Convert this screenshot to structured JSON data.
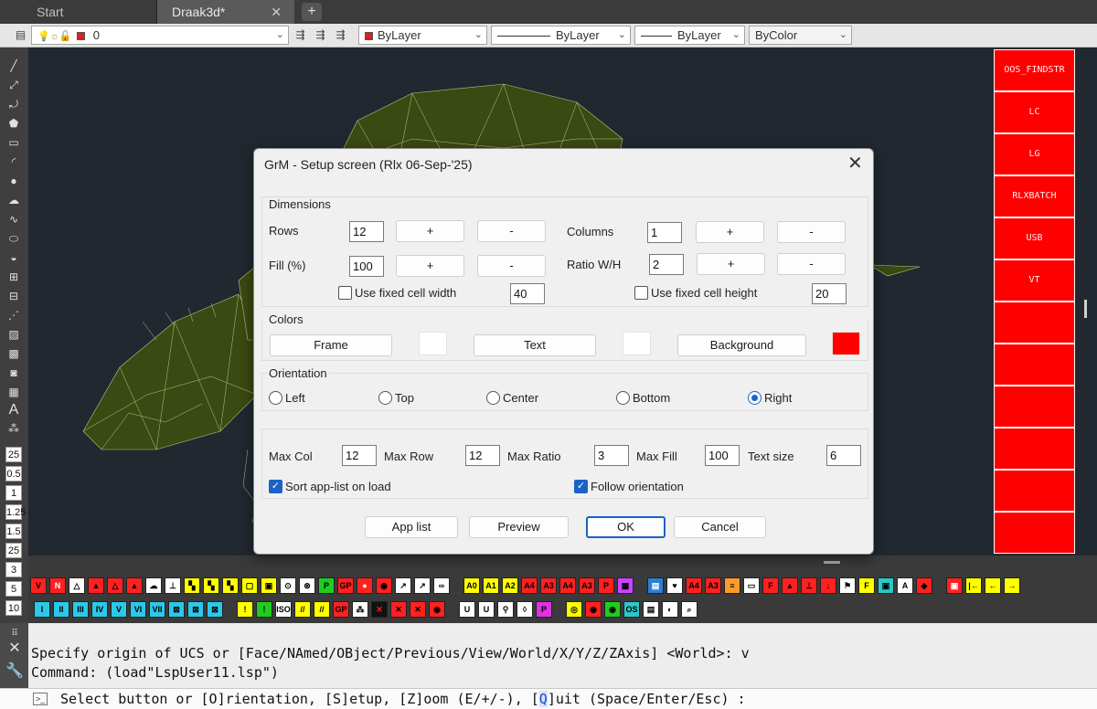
{
  "tabs": {
    "start": "Start",
    "active": "Draak3d*",
    "close_glyph": "✕",
    "new_glyph": "+"
  },
  "propbar": {
    "layer_value": "0",
    "color_value": "ByLayer",
    "linetype_value": "ByLayer",
    "lineweight_value": "ByLayer",
    "plotstyle_value": "ByColor"
  },
  "left_numbers": [
    "25",
    "0.5",
    "1",
    "1.25",
    "1.5",
    "25",
    "3",
    "5",
    "10"
  ],
  "red_panel": {
    "items": [
      "OOS_FINDSTR",
      "LC",
      "LG",
      "RLXBATCH",
      "USB",
      "VT",
      "",
      "",
      "",
      "",
      "",
      ""
    ]
  },
  "dialog": {
    "title": "GrM - Setup screen (Rlx 06-Sep-'25)",
    "close_glyph": "✕",
    "dimensions": {
      "label": "Dimensions",
      "rows_label": "Rows",
      "rows_value": "12",
      "fill_label": "Fill  (%)",
      "fill_value": "100",
      "columns_label": "Columns",
      "columns_value": "1",
      "ratio_label": "Ratio W/H",
      "ratio_value": "2",
      "plus": "+",
      "minus": "-",
      "fixed_width_label": "Use fixed cell width",
      "fixed_width_value": "40",
      "fixed_height_label": "Use fixed cell height",
      "fixed_height_value": "20"
    },
    "colors": {
      "label": "Colors",
      "frame_label": "Frame",
      "text_label": "Text",
      "background_label": "Background",
      "frame_color": "#ffffff",
      "text_color": "#ffffff",
      "background_color": "#ff0000"
    },
    "orientation": {
      "label": "Orientation",
      "options": [
        "Left",
        "Top",
        "Center",
        "Bottom",
        "Right"
      ],
      "selected": "Right"
    },
    "limits": {
      "max_col_label": "Max Col",
      "max_col_value": "12",
      "max_row_label": "Max Row",
      "max_row_value": "12",
      "max_ratio_label": "Max Ratio",
      "max_ratio_value": "3",
      "max_fill_label": "Max Fill",
      "max_fill_value": "100",
      "text_size_label": "Text size",
      "text_size_value": "6",
      "sort_label": "Sort app-list on load",
      "sort_checked": true,
      "follow_label": "Follow orientation",
      "follow_checked": true
    },
    "buttons": {
      "app_list": "App list",
      "preview": "Preview",
      "ok": "OK",
      "cancel": "Cancel"
    }
  },
  "command": {
    "line1": "Specify origin of UCS or [Face/NAmed/OBject/Previous/View/World/X/Y/Z/ZAxis] <World>: v",
    "line2": "Command: (load\"LspUser11.lsp\")",
    "prompt_before": "Select button or [O]rientation, [S]etup, [Z]oom (E/+/-), [",
    "prompt_q": "Q",
    "prompt_after": "]uit (Space/Enter/Esc) :"
  },
  "tool_rows": {
    "row1": [
      {
        "t": "V",
        "bg": "#ff2020",
        "fg": "#000"
      },
      {
        "t": "N",
        "bg": "#ff2020",
        "fg": "#fff"
      },
      {
        "t": "△",
        "bg": "#ffffff",
        "fg": "#000"
      },
      {
        "t": "▲",
        "bg": "#ff2020",
        "fg": "#000"
      },
      {
        "t": "△",
        "bg": "#ff2020",
        "fg": "#000"
      },
      {
        "t": "▲",
        "bg": "#ff2020",
        "fg": "#000"
      },
      {
        "t": "☁",
        "bg": "#ffffff",
        "fg": "#000"
      },
      {
        "t": "⊥",
        "bg": "#ffffff",
        "fg": "#000"
      },
      {
        "t": "▚",
        "bg": "#ffff00",
        "fg": "#000"
      },
      {
        "t": "▚",
        "bg": "#ffff00",
        "fg": "#000"
      },
      {
        "t": "▚",
        "bg": "#ffff00",
        "fg": "#000"
      },
      {
        "t": "▢",
        "bg": "#ffff00",
        "fg": "#000"
      },
      {
        "t": "▣",
        "bg": "#ffff00",
        "fg": "#000"
      },
      {
        "t": "⊙",
        "bg": "#ffffff",
        "fg": "#000"
      },
      {
        "t": "⊗",
        "bg": "#ffffff",
        "fg": "#000"
      },
      {
        "t": "P",
        "bg": "#20cc20",
        "fg": "#000"
      },
      {
        "t": "GP",
        "bg": "#ff2020",
        "fg": "#000"
      },
      {
        "t": "●",
        "bg": "#ff2020",
        "fg": "#fff"
      },
      {
        "t": "◉",
        "bg": "#ff2020",
        "fg": "#000"
      },
      {
        "t": "↗",
        "bg": "#ffffff",
        "fg": "#000"
      },
      {
        "t": "↗",
        "bg": "#ffffff",
        "fg": "#000"
      },
      {
        "t": "∞",
        "bg": "#ffffff",
        "fg": "#000"
      },
      {
        "t": "A0",
        "bg": "#ffff00",
        "fg": "#000"
      },
      {
        "t": "A1",
        "bg": "#ffff00",
        "fg": "#000"
      },
      {
        "t": "A2",
        "bg": "#ffff00",
        "fg": "#000"
      },
      {
        "t": "A4",
        "bg": "#ff2020",
        "fg": "#000"
      },
      {
        "t": "A3",
        "bg": "#ff2020",
        "fg": "#000"
      },
      {
        "t": "A4",
        "bg": "#ff2020",
        "fg": "#000"
      },
      {
        "t": "A3",
        "bg": "#ff2020",
        "fg": "#000"
      },
      {
        "t": "P",
        "bg": "#ff2020",
        "fg": "#000"
      },
      {
        "t": "▦",
        "bg": "#cc44ff",
        "fg": "#000"
      },
      {
        "t": "▤",
        "bg": "#2c7fd8",
        "fg": "#fff"
      },
      {
        "t": "♥",
        "bg": "#ffffff",
        "fg": "#000"
      },
      {
        "t": "A4",
        "bg": "#ff2020",
        "fg": "#000"
      },
      {
        "t": "A3",
        "bg": "#ff2020",
        "fg": "#000"
      },
      {
        "t": "≡",
        "bg": "#ff9a2c",
        "fg": "#000"
      },
      {
        "t": "▭",
        "bg": "#ffffff",
        "fg": "#000"
      },
      {
        "t": "F",
        "bg": "#ff2020",
        "fg": "#000"
      },
      {
        "t": "▲",
        "bg": "#ff2020",
        "fg": "#000"
      },
      {
        "t": "⊥",
        "bg": "#ff2020",
        "fg": "#000"
      },
      {
        "t": "↓",
        "bg": "#ff2020",
        "fg": "#000"
      },
      {
        "t": "⚑",
        "bg": "#ffffff",
        "fg": "#000"
      },
      {
        "t": "F",
        "bg": "#ffff00",
        "fg": "#000"
      },
      {
        "t": "▣",
        "bg": "#2cc8c8",
        "fg": "#000"
      },
      {
        "t": "A",
        "bg": "#ffffff",
        "fg": "#000"
      },
      {
        "t": "◆",
        "bg": "#ff2020",
        "fg": "#000"
      },
      {
        "t": "▣",
        "bg": "#ff2020",
        "fg": "#fff"
      },
      {
        "t": "|←",
        "bg": "#ffff00",
        "fg": "#000"
      },
      {
        "t": "←",
        "bg": "#ffff00",
        "fg": "#000"
      },
      {
        "t": "→",
        "bg": "#ffff00",
        "fg": "#000"
      }
    ],
    "row2": [
      {
        "t": "I",
        "bg": "#2cc8e8",
        "fg": "#000"
      },
      {
        "t": "II",
        "bg": "#2cc8e8",
        "fg": "#000"
      },
      {
        "t": "III",
        "bg": "#2cc8e8",
        "fg": "#000"
      },
      {
        "t": "IV",
        "bg": "#2cc8e8",
        "fg": "#000"
      },
      {
        "t": "V",
        "bg": "#2cc8e8",
        "fg": "#000"
      },
      {
        "t": "VI",
        "bg": "#2cc8e8",
        "fg": "#000"
      },
      {
        "t": "VII",
        "bg": "#2cc8e8",
        "fg": "#000"
      },
      {
        "t": "⊠",
        "bg": "#2cc8e8",
        "fg": "#000"
      },
      {
        "t": "⊠",
        "bg": "#2cc8e8",
        "fg": "#000"
      },
      {
        "t": "⊠",
        "bg": "#2cc8e8",
        "fg": "#000"
      },
      {
        "t": "!",
        "bg": "#ffff00",
        "fg": "#000"
      },
      {
        "t": "!",
        "bg": "#20cc20",
        "fg": "#000"
      },
      {
        "t": "ISO",
        "bg": "#ffffff",
        "fg": "#000"
      },
      {
        "t": "//",
        "bg": "#ffff00",
        "fg": "#000"
      },
      {
        "t": "//",
        "bg": "#ffff00",
        "fg": "#000"
      },
      {
        "t": "GP",
        "bg": "#ff2020",
        "fg": "#000"
      },
      {
        "t": "⁂",
        "bg": "#ffffff",
        "fg": "#000"
      },
      {
        "t": "✕",
        "bg": "#111111",
        "fg": "#ff2020"
      },
      {
        "t": "✕",
        "bg": "#ff2020",
        "fg": "#000"
      },
      {
        "t": "✕",
        "bg": "#ff2020",
        "fg": "#000"
      },
      {
        "t": "◉",
        "bg": "#ff2020",
        "fg": "#000"
      },
      {
        "t": "U",
        "bg": "#ffffff",
        "fg": "#000"
      },
      {
        "t": "U",
        "bg": "#ffffff",
        "fg": "#000"
      },
      {
        "t": "⚲",
        "bg": "#ffffff",
        "fg": "#000"
      },
      {
        "t": "◊",
        "bg": "#ffffff",
        "fg": "#000"
      },
      {
        "t": "P",
        "bg": "#dd33dd",
        "fg": "#000"
      },
      {
        "t": "◎",
        "bg": "#ffff00",
        "fg": "#000"
      },
      {
        "t": "◉",
        "bg": "#ff2020",
        "fg": "#000"
      },
      {
        "t": "◉",
        "bg": "#20cc20",
        "fg": "#000"
      },
      {
        "t": "OS",
        "bg": "#2cc8c8",
        "fg": "#000"
      },
      {
        "t": "▤",
        "bg": "#ffffff",
        "fg": "#000"
      },
      {
        "t": "◐",
        "bg": "#ffffff",
        "fg": "#000"
      },
      {
        "t": "⌕",
        "bg": "#ffffff",
        "fg": "#000"
      }
    ]
  }
}
